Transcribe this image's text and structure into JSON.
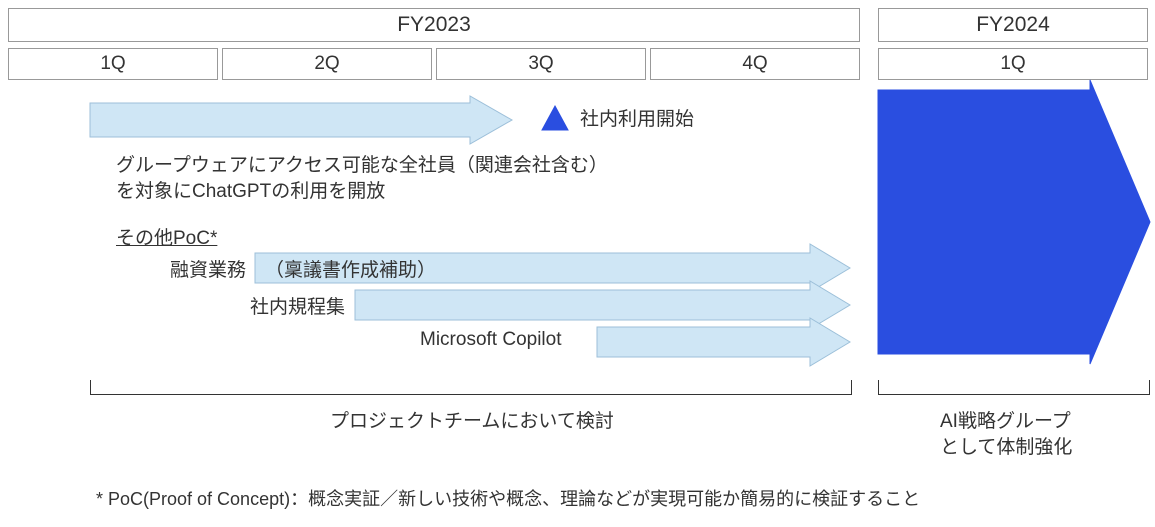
{
  "chart_data": {
    "type": "timeline-gantt",
    "fiscal_years": [
      {
        "label": "FY2023",
        "quarters": [
          "1Q",
          "2Q",
          "3Q",
          "4Q"
        ]
      },
      {
        "label": "FY2024",
        "quarters": [
          "1Q"
        ]
      }
    ],
    "arrows": [
      {
        "name": "chatgpt_rollout",
        "start": "FY2023-1Q-mid",
        "end": "FY2023-3Q-early",
        "color": "lightblue",
        "milestone_after": {
          "label": "社内利用開始",
          "symbol": "triangle",
          "color": "blue"
        }
      },
      {
        "name": "poc_loan",
        "label_left": "融資業務",
        "label_inside": "（稟議書作成補助）",
        "start": "FY2023-2Q-early",
        "end": "FY2023-4Q-end",
        "color": "lightblue"
      },
      {
        "name": "poc_rules",
        "label_left": "社内規程集",
        "start": "FY2023-2Q-mid",
        "end": "FY2023-4Q-end",
        "color": "lightblue"
      },
      {
        "name": "poc_copilot",
        "label_left": "Microsoft Copilot",
        "start": "FY2023-3Q-mid",
        "end": "FY2023-4Q-end",
        "color": "lightblue"
      },
      {
        "name": "fy2024_big",
        "start": "FY2024-1Q-start",
        "end": "FY2024-1Q-end",
        "color": "royalblue",
        "height": "large"
      }
    ],
    "section_title_poc": "その他PoC*",
    "group_brackets": [
      {
        "range": "FY2023-1Q-mid→FY2023-4Q-end",
        "label": "プロジェクトチームにおいて検討"
      },
      {
        "range": "FY2024",
        "label": "AI戦略グループ\nとして体制強化"
      }
    ],
    "phase1_description": "グループウェアにアクセス可能な全社員（関連会社含む）\nを対象にChatGPTの利用を開放",
    "footnote": "* PoC(Proof of Concept)：概念実証／新しい技術や概念、理論などが実現可能か簡易的に検証すること"
  },
  "text": {
    "fy2023": "FY2023",
    "fy2024": "FY2024",
    "q1": "1Q",
    "q2": "2Q",
    "q3": "3Q",
    "q4": "4Q",
    "q1b": "1Q",
    "milestone": "社内利用開始",
    "desc_line1": "グループウェアにアクセス可能な全社員（関連会社含む）",
    "desc_line2": "を対象にChatGPTの利用を開放",
    "poc_title": "その他PoC*",
    "poc1_left": "融資業務",
    "poc1_inside": "（稟議書作成補助）",
    "poc2_left": "社内規程集",
    "poc3_left": "Microsoft Copilot",
    "bracket1": "プロジェクトチームにおいて検討",
    "bracket2a": "AI戦略グループ",
    "bracket2b": "として体制強化",
    "footnote": "* PoC(Proof of Concept)：概念実証／新しい技術や概念、理論などが実現可能か簡易的に検証すること"
  }
}
